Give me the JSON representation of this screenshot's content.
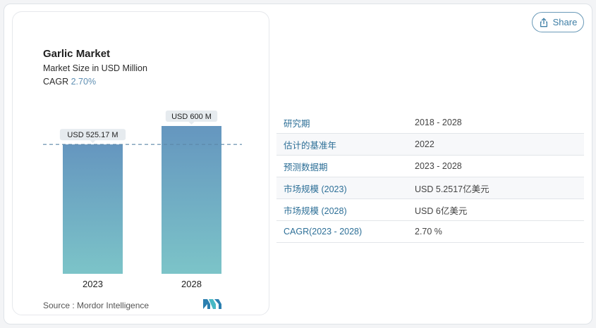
{
  "share": {
    "label": "Share",
    "icon": "share-icon"
  },
  "chart": {
    "title": "Garlic Market",
    "subtitle": "Market Size in USD Million",
    "cagr_label": "CAGR",
    "cagr_value": "2.70%",
    "source": "Source :  Mordor Intelligence",
    "logo": "mordor-intelligence-logo"
  },
  "chart_data": {
    "type": "bar",
    "categories": [
      "2023",
      "2028"
    ],
    "values": [
      525.17,
      600
    ],
    "data_labels": [
      "USD 525.17 M",
      "USD 600 M"
    ],
    "title": "Garlic Market",
    "subtitle": "Market Size in USD Million",
    "xlabel": "",
    "ylabel": "",
    "ylim": [
      0,
      600
    ],
    "reference_line": 525.17,
    "grid": false,
    "colors": {
      "bar_top": "#6596bf",
      "bar_bottom": "#7cc4c8",
      "reference_line": "#5b86a8",
      "label_bg": "#e6ebef"
    }
  },
  "table": {
    "rows": [
      {
        "label": "研究期",
        "value": "2018 - 2028"
      },
      {
        "label": "估计的基准年",
        "value": "2022"
      },
      {
        "label": "预测数据期",
        "value": "2023 - 2028"
      },
      {
        "label": "市场规模 (2023)",
        "value": "USD 5.2517亿美元"
      },
      {
        "label": "市场规模 (2028)",
        "value": "USD 6亿美元"
      },
      {
        "label": "CAGR(2023 - 2028)",
        "value": "2.70 %"
      }
    ]
  }
}
